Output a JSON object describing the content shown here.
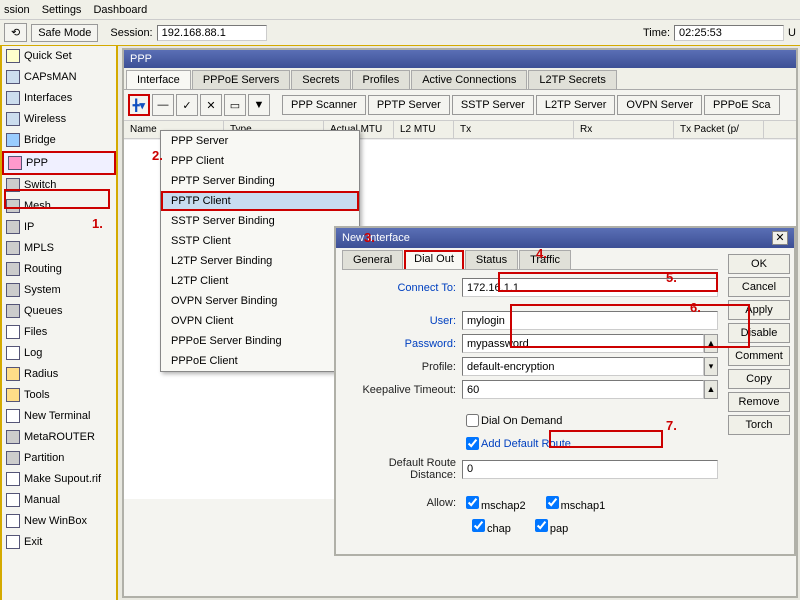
{
  "menubar": {
    "items": [
      "ssion",
      "Settings",
      "Dashboard"
    ]
  },
  "toolbar": {
    "back": "⟲",
    "safe_mode": "Safe Mode",
    "session_label": "Session:",
    "session_value": "192.168.88.1",
    "time_label": "Time:",
    "time_value": "02:25:53",
    "uptime_label": "U"
  },
  "sidebar": {
    "items": [
      {
        "label": "Quick Set",
        "ico": "wand"
      },
      {
        "label": "CAPsMAN",
        "ico": "wifi"
      },
      {
        "label": "Interfaces",
        "ico": "wifi"
      },
      {
        "label": "Wireless",
        "ico": "wifi"
      },
      {
        "label": "Bridge",
        "ico": "bridge"
      },
      {
        "label": "PPP",
        "ico": "ppp",
        "selected": true
      },
      {
        "label": "Switch",
        "ico": "sys"
      },
      {
        "label": "Mesh",
        "ico": "sys"
      },
      {
        "label": "IP",
        "ico": "sys"
      },
      {
        "label": "MPLS",
        "ico": "sys"
      },
      {
        "label": "Routing",
        "ico": "sys"
      },
      {
        "label": "System",
        "ico": "sys"
      },
      {
        "label": "Queues",
        "ico": "sys"
      },
      {
        "label": "Files",
        "ico": "log"
      },
      {
        "label": "Log",
        "ico": "log"
      },
      {
        "label": "Radius",
        "ico": "tool"
      },
      {
        "label": "Tools",
        "ico": "tool"
      },
      {
        "label": "New Terminal",
        "ico": "log"
      },
      {
        "label": "MetaROUTER",
        "ico": "sys"
      },
      {
        "label": "Partition",
        "ico": "sys"
      },
      {
        "label": "Make Supout.rif",
        "ico": "log"
      },
      {
        "label": "Manual",
        "ico": "log"
      },
      {
        "label": "New WinBox",
        "ico": "log"
      },
      {
        "label": "Exit",
        "ico": "log"
      }
    ]
  },
  "ppp": {
    "title": "PPP",
    "tabs": [
      "Interface",
      "PPPoE Servers",
      "Secrets",
      "Profiles",
      "Active Connections",
      "L2TP Secrets"
    ],
    "active_tab": 0,
    "add_symbol": "╋▾",
    "remove_symbol": "—",
    "srv_buttons": [
      "PPP Scanner",
      "PPTP Server",
      "SSTP Server",
      "L2TP Server",
      "OVPN Server",
      "PPPoE Sca"
    ],
    "columns": [
      "Name",
      "Type",
      "Actual MTU",
      "L2 MTU",
      "Tx",
      "Rx",
      "Tx Packet (p/"
    ],
    "dropdown": [
      "PPP Server",
      "PPP Client",
      "PPTP Server Binding",
      "PPTP Client",
      "SSTP Server Binding",
      "SSTP Client",
      "L2TP Server Binding",
      "L2TP Client",
      "OVPN Server Binding",
      "OVPN Client",
      "PPPoE Server Binding",
      "PPPoE Client"
    ],
    "dropdown_hl": 3
  },
  "dialog": {
    "title": "New Interface",
    "tabs": [
      "General",
      "Dial Out",
      "Status",
      "Traffic"
    ],
    "active_tab": 1,
    "fields": {
      "connect_to_label": "Connect To:",
      "connect_to": "172.16.1.1",
      "user_label": "User:",
      "user": "mylogin",
      "password_label": "Password:",
      "password": "mypassword",
      "profile_label": "Profile:",
      "profile": "default-encryption",
      "keepalive_label": "Keepalive Timeout:",
      "keepalive": "60",
      "dial_on_demand_label": "Dial On Demand",
      "add_default_route_label": "Add Default Route",
      "default_route_dist_label": "Default Route Distance:",
      "default_route_dist": "0",
      "allow_label": "Allow:",
      "allow_opts": [
        "mschap2",
        "mschap1",
        "chap",
        "pap"
      ]
    },
    "buttons": [
      "OK",
      "Cancel",
      "Apply",
      "Disable",
      "Comment",
      "Copy",
      "Remove",
      "Torch"
    ]
  },
  "annotations": {
    "n1": "1.",
    "n2": "2.",
    "n3": "3.",
    "n4": "4.",
    "n5": "5.",
    "n6": "6.",
    "n7": "7."
  }
}
